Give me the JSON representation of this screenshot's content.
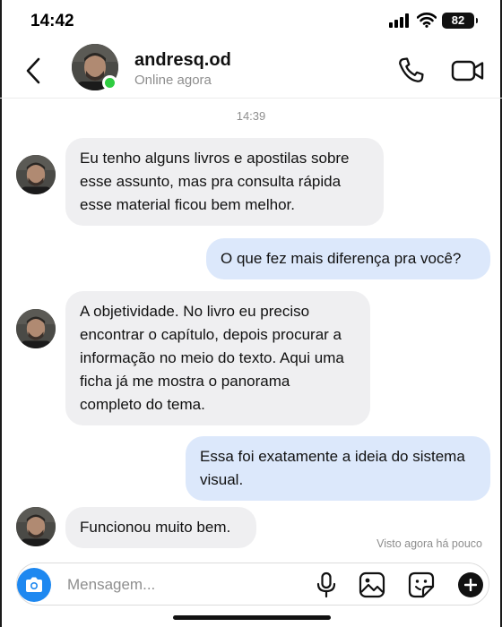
{
  "status_bar": {
    "time": "14:42",
    "battery": "82"
  },
  "header": {
    "contact_name": "andresq.od",
    "contact_status": "Online agora",
    "icons": {
      "back": "chevron-left-icon",
      "call": "phone-icon",
      "video": "video-camera-icon"
    }
  },
  "chat": {
    "timestamp": "14:39",
    "messages": [
      {
        "direction": "incoming",
        "text": "Eu tenho alguns livros e apostilas sobre esse assunto, mas pra consulta rápida esse material ficou bem melhor."
      },
      {
        "direction": "outgoing",
        "text": "O que fez mais diferença pra você?"
      },
      {
        "direction": "incoming",
        "text": "A objetividade. No livro eu preciso encontrar o capítulo, depois procurar a informação no meio do texto. Aqui uma ficha já me mostra o panorama completo do tema."
      },
      {
        "direction": "outgoing",
        "text": "Essa foi exatamente a ideia do sistema visual."
      },
      {
        "direction": "incoming",
        "text": "Funcionou muito bem."
      }
    ],
    "seen_status": "Visto agora há pouco"
  },
  "composer": {
    "placeholder": "Mensagem...",
    "value": "",
    "icons": [
      "camera-icon",
      "microphone-icon",
      "image-icon",
      "sticker-icon",
      "plus-icon"
    ]
  },
  "colors": {
    "incoming_bubble": "#efeff1",
    "outgoing_bubble": "#dce8fb",
    "accent": "#1e88f0",
    "online": "#2ecc40"
  }
}
